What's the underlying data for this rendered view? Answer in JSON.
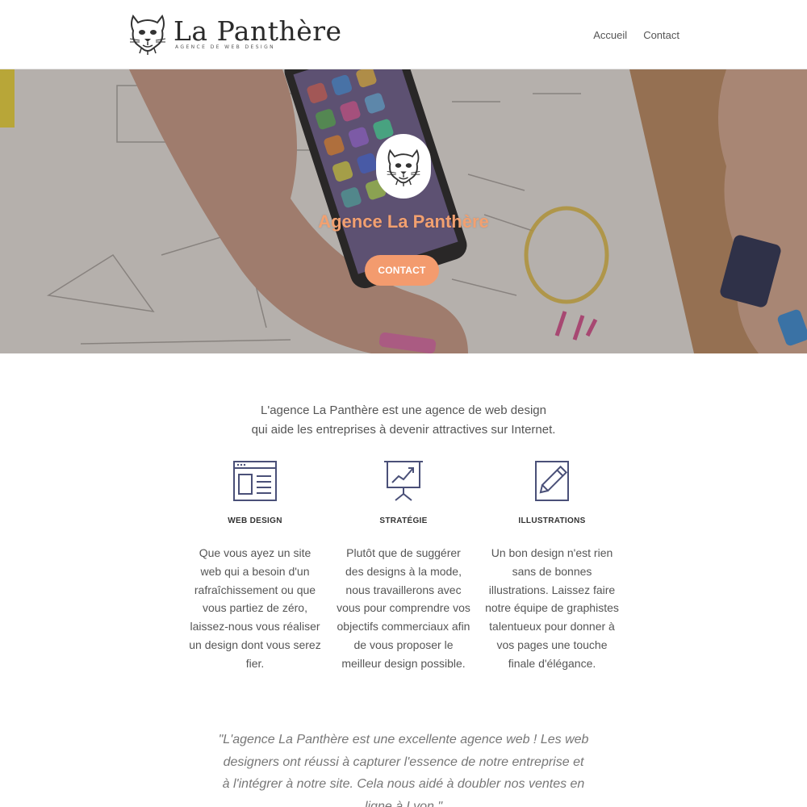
{
  "header": {
    "logo_title": "La Panthère",
    "logo_tagline": "AGENCE DE WEB DESIGN",
    "nav": [
      "Accueil",
      "Contact"
    ]
  },
  "hero": {
    "title": "Agence La Panthère",
    "button_label": "CONTACT"
  },
  "intro": {
    "line1": "L'agence La Panthère est une agence de web design",
    "line2": "qui aide les entreprises à devenir attractives sur Internet."
  },
  "features": [
    {
      "icon": "web-design-icon",
      "title": "WEB DESIGN",
      "text": "Que vous ayez un site web qui a besoin d'un rafraîchissement ou que vous partiez de zéro, laissez-nous vous réaliser un design dont vous serez fier."
    },
    {
      "icon": "strategy-chart-icon",
      "title": "STRATÉGIE",
      "text": "Plutôt que de suggérer des designs à la mode, nous travaillerons avec vous pour comprendre vos objectifs commerciaux afin de vous proposer le meilleur design possible."
    },
    {
      "icon": "pencil-icon",
      "title": "ILLUSTRATIONS",
      "text": "Un bon design n'est rien sans de bonnes illustrations. Laissez faire notre équipe de graphistes talentueux pour donner à vos pages une touche finale d'élégance."
    }
  ],
  "testimonial": {
    "text": "\"L'agence La Panthère est une excellente agence web ! Les web designers ont réussi à capturer l'essence de notre entreprise et à l'intégrer à notre site. Cela nous aidé à doubler nos ventes en ligne à Lyon.\""
  },
  "colors": {
    "accent": "#f39b6e",
    "hero_title": "#f2a070",
    "icon_stroke": "#4a5078"
  }
}
